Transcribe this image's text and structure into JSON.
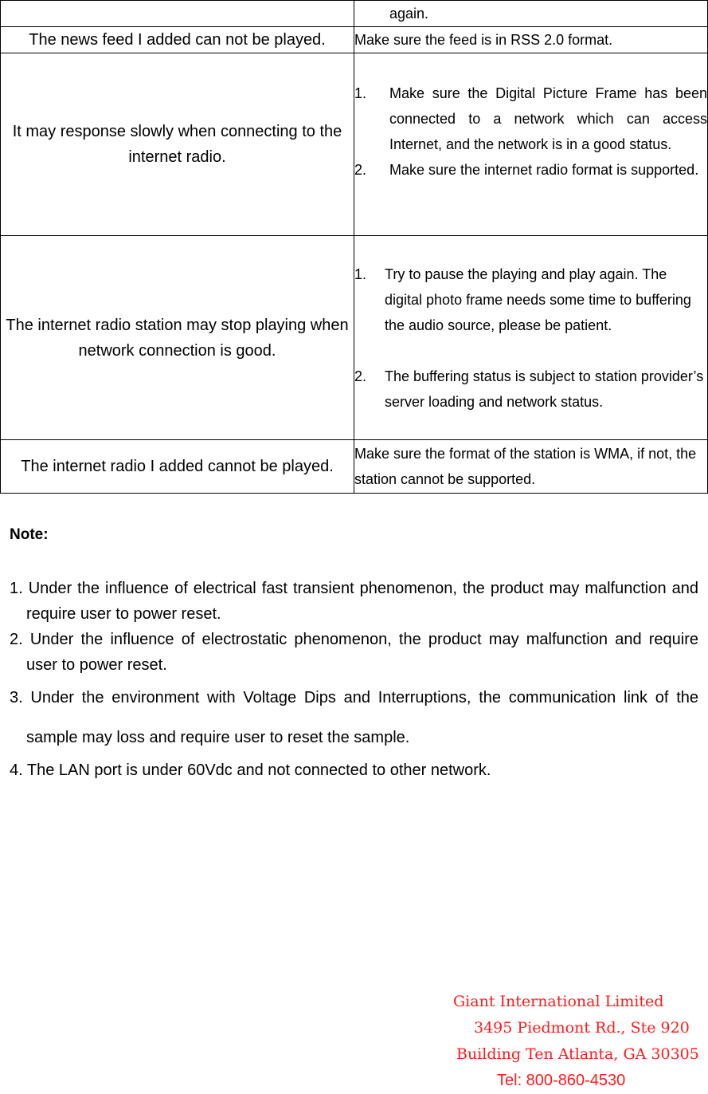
{
  "table": {
    "rows": [
      {
        "problem": "",
        "solution_text": "again."
      },
      {
        "problem": "The news feed I added can not be played.",
        "solution_text": "Make sure the feed is in RSS 2.0 format."
      },
      {
        "problem": "It may response slowly when connecting to the internet radio.",
        "solution_items": [
          {
            "num": "1.",
            "text": "Make sure the Digital Picture Frame has been connected to a network which can access Internet, and the network is in a good status."
          },
          {
            "num": "2.",
            "text": "Make sure the internet radio format is supported."
          }
        ]
      },
      {
        "problem": "The internet radio station may stop playing when network connection is good.",
        "solution_items": [
          {
            "num": "1.",
            "text": "Try to pause the playing and play again. The digital photo frame needs some time to buffering the audio source, please be patient."
          },
          {
            "num": "2.",
            "text": "The buffering status is subject to station provider’s server loading and network status."
          }
        ]
      },
      {
        "problem": "The internet radio I added cannot be played.",
        "solution_text": "Make sure the format of the station is WMA, if not, the station cannot be supported."
      }
    ]
  },
  "note": {
    "heading": "Note:",
    "items": [
      "1. Under the influence of electrical fast transient phenomenon, the product may malfunction and require user to power reset.",
      "2. Under the influence of electrostatic phenomenon, the product may malfunction and require user to power reset.",
      "3. Under the environment with Voltage Dips and Interruptions, the communication link of the sample may loss and require user to reset the sample.",
      "4.  The LAN port is under 60Vdc and not connected to other network."
    ]
  },
  "address": {
    "company": "Giant International Limited",
    "street": "3495 Piedmont Rd., Ste 920",
    "city": "Building Ten Atlanta, GA 30305",
    "tel": "Tel: 800-860-4530",
    "color": "#ff1a1a"
  }
}
